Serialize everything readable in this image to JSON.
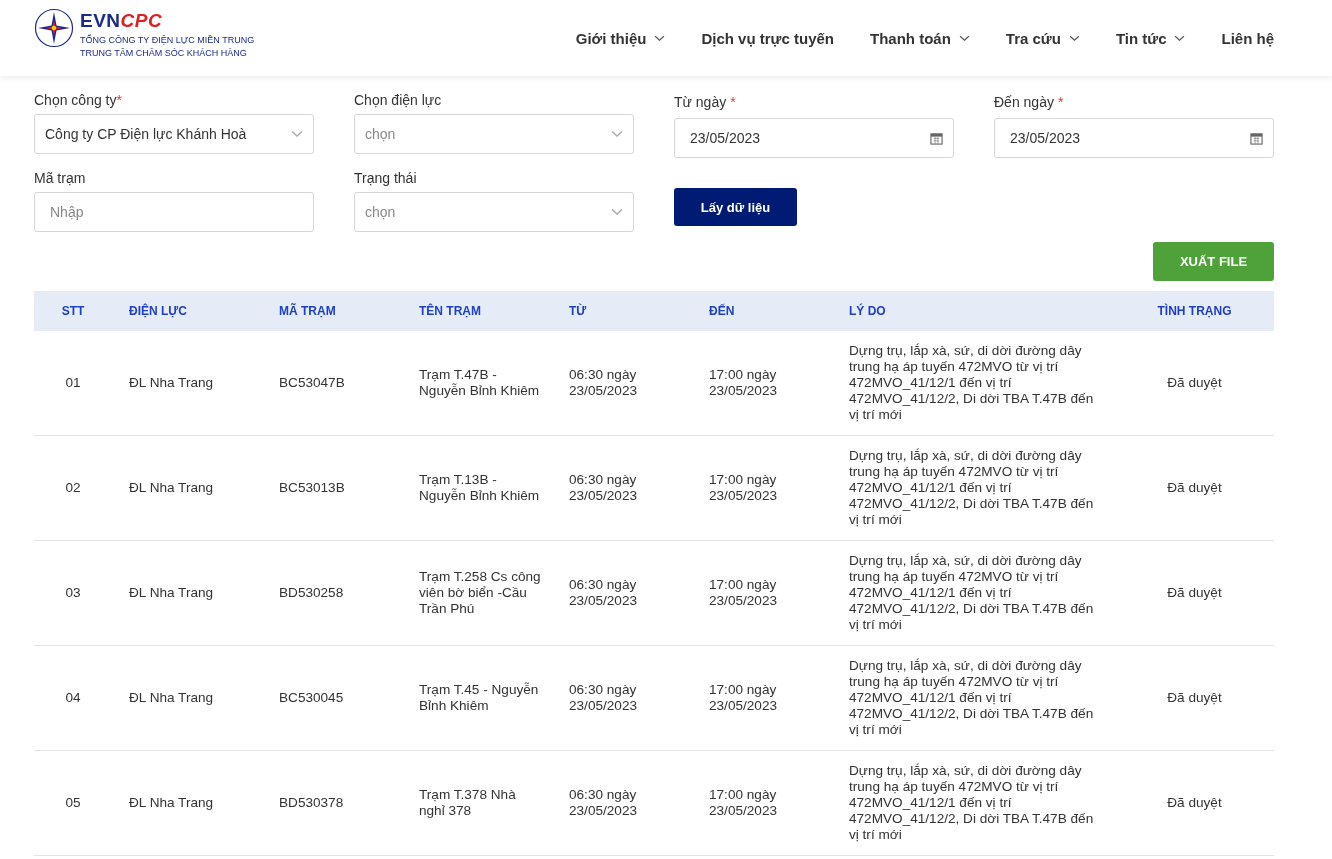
{
  "header": {
    "logo": {
      "brand_main": "EVN",
      "brand_accent": "CPC",
      "line_1": "TỔNG CÔNG TY ĐIỆN LỰC MIỀN TRUNG",
      "line_2": "TRUNG TÂM CHĂM SÓC KHÁCH HÀNG"
    },
    "nav": [
      {
        "label": "Giới thiệu",
        "has_menu": true
      },
      {
        "label": "Dịch vụ trực tuyến",
        "has_menu": false
      },
      {
        "label": "Thanh toán",
        "has_menu": true
      },
      {
        "label": "Tra cứu",
        "has_menu": true
      },
      {
        "label": "Tin tức",
        "has_menu": true
      },
      {
        "label": "Liên hệ",
        "has_menu": false
      }
    ]
  },
  "filters": [
    {
      "kind": "select",
      "label": "Chọn công ty",
      "required": true,
      "value": "Công ty CP Điện lực Khánh Hoà"
    },
    {
      "kind": "select",
      "label": "Chọn điện lực",
      "required": false,
      "placeholder": "chọn"
    },
    {
      "kind": "date",
      "label": "Từ ngày",
      "required": true,
      "value": "23/05/2023"
    },
    {
      "kind": "date",
      "label": "Đến ngày",
      "required": true,
      "value": "23/05/2023"
    },
    {
      "kind": "text",
      "label": "Mã trạm",
      "required": false,
      "placeholder": "Nhập"
    },
    {
      "kind": "select",
      "label": "Trạng thái",
      "required": false,
      "placeholder": "chọn"
    }
  ],
  "required_mark": "*",
  "fetch_button": "Lấy dữ liệu",
  "export_button": "XUẤT FILE",
  "table": {
    "columns": [
      "STT",
      "ĐIỆN LỰC",
      "MÃ TRẠM",
      "TÊN TRẠM",
      "TỪ",
      "ĐẾN",
      "LÝ DO",
      "TÌNH TRẠNG"
    ],
    "rows": [
      [
        "01",
        "ĐL Nha Trang",
        "BC53047B",
        "Trạm T.47B - Nguyễn Bỉnh Khiêm",
        "06:30 ngày 23/05/2023",
        "17:00 ngày 23/05/2023",
        "Dựng trụ, lắp xà, sứ, di dời đường dây trung hạ áp tuyến 472MVO từ vị trí 472MVO_41/12/1 đến vị trí 472MVO_41/12/2, Di dời TBA T.47B đến vị trí mới",
        "Đã duyệt"
      ],
      [
        "02",
        "ĐL Nha Trang",
        "BC53013B",
        "Trạm T.13B - Nguyễn Bỉnh Khiêm",
        "06:30 ngày 23/05/2023",
        "17:00 ngày 23/05/2023",
        "Dựng trụ, lắp xà, sứ, di dời đường dây trung hạ áp tuyến 472MVO từ vị trí 472MVO_41/12/1 đến vị trí 472MVO_41/12/2, Di dời TBA T.47B đến vị trí mới",
        "Đã duyệt"
      ],
      [
        "03",
        "ĐL Nha Trang",
        "BD530258",
        "Trạm T.258 Cs công viên bờ biển -Cầu Trần Phú",
        "06:30 ngày 23/05/2023",
        "17:00 ngày 23/05/2023",
        "Dựng trụ, lắp xà, sứ, di dời đường dây trung hạ áp tuyến 472MVO từ vị trí 472MVO_41/12/1 đến vị trí 472MVO_41/12/2, Di dời TBA T.47B đến vị trí mới",
        "Đã duyệt"
      ],
      [
        "04",
        "ĐL Nha Trang",
        "BC530045",
        "Trạm T.45 - Nguyễn Bỉnh Khiêm",
        "06:30 ngày 23/05/2023",
        "17:00 ngày 23/05/2023",
        "Dựng trụ, lắp xà, sứ, di dời đường dây trung hạ áp tuyến 472MVO từ vị trí 472MVO_41/12/1 đến vị trí 472MVO_41/12/2, Di dời TBA T.47B đến vị trí mới",
        "Đã duyệt"
      ],
      [
        "05",
        "ĐL Nha Trang",
        "BD530378",
        "Trạm T.378 Nhà nghỉ 378",
        "06:30 ngày 23/05/2023",
        "17:00 ngày 23/05/2023",
        "Dựng trụ, lắp xà, sứ, di dời đường dây trung hạ áp tuyến 472MVO từ vị trí 472MVO_41/12/1 đến vị trí 472MVO_41/12/2, Di dời TBA T.47B đến vị trí mới",
        "Đã duyệt"
      ]
    ]
  }
}
